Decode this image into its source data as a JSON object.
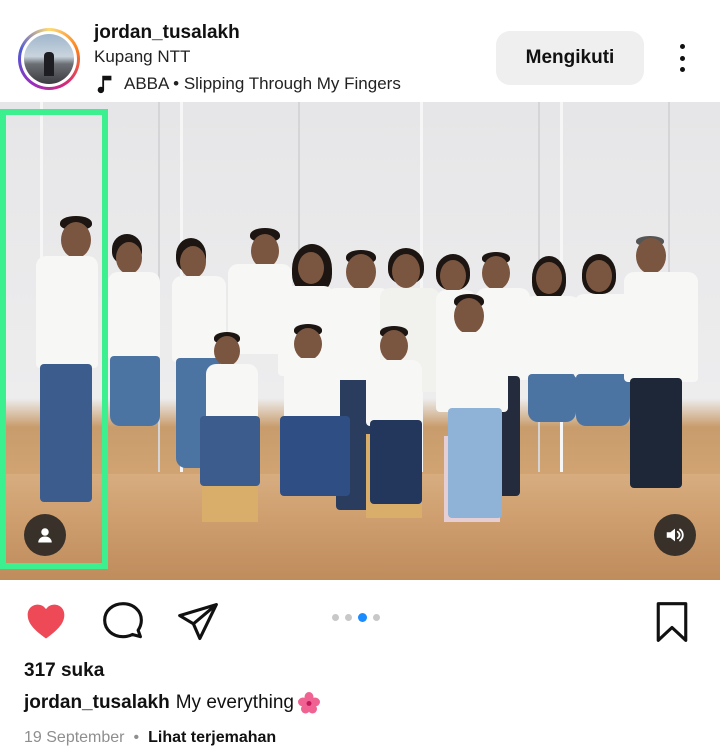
{
  "post": {
    "username": "jordan_tusalakh",
    "location": "Kupang NTT",
    "music": "ABBA • Slipping Through My Fingers",
    "follow_label": "Mengikuti",
    "photo_alt": "Family group portrait",
    "carousel": {
      "count": 4,
      "active_index": 2
    },
    "likes": "317 suka",
    "caption_user": "jordan_tusalakh",
    "caption_text": "My everything",
    "date": "19 September",
    "separator": "•",
    "translate_label": "Lihat terjemahan"
  },
  "icons": {
    "music": "music-note-icon",
    "more": "more-vertical-icon",
    "user_tag": "user-tag-icon",
    "sound": "sound-on-icon",
    "like": "heart-filled-icon",
    "comment": "comment-icon",
    "share": "send-icon",
    "save": "bookmark-icon",
    "flower": "hibiscus-emoji-icon"
  },
  "colors": {
    "like_red": "#ed4956",
    "carousel_active": "#1a8cff",
    "highlight_box": "#3df08f",
    "follow_bg": "#efefef"
  }
}
